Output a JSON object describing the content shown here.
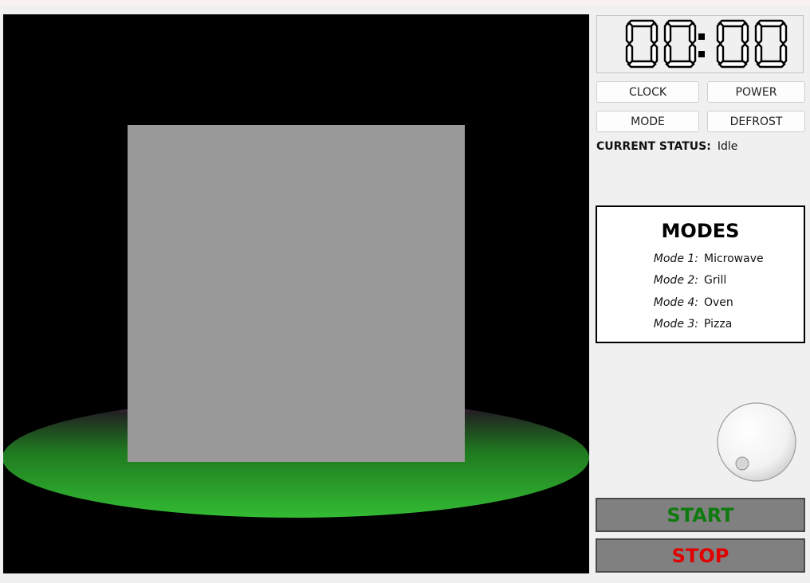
{
  "display": {
    "time": "00:00",
    "digit_color": "#000000"
  },
  "buttons": {
    "clock": "CLOCK",
    "power": "POWER",
    "mode": "MODE",
    "defrost": "DEFROST"
  },
  "status": {
    "label": "CURRENT STATUS:",
    "value": "Idle"
  },
  "modes": {
    "title": "MODES",
    "items": [
      {
        "label": "Mode 1:",
        "value": "Microwave"
      },
      {
        "label": "Mode 2:",
        "value": "Grill"
      },
      {
        "label": "Mode 4:",
        "value": "Oven"
      },
      {
        "label": "Mode 3:",
        "value": "Pizza"
      }
    ]
  },
  "actions": {
    "start": "START",
    "stop": "STOP",
    "start_color": "#0f7a0f",
    "stop_color": "#e00000"
  },
  "scene": {
    "background": "#000000",
    "food_color": "#999999",
    "plate_color": "#33bb33",
    "plate_glow_color": "#8a1f8a"
  }
}
